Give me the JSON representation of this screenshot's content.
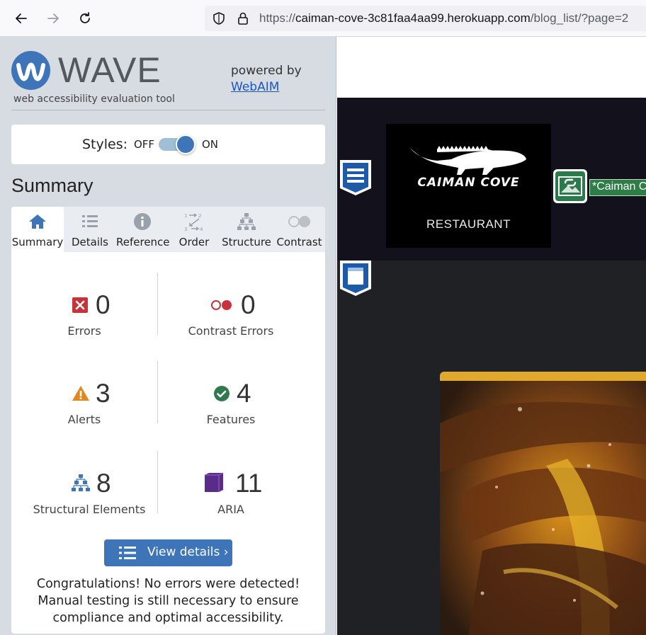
{
  "browser": {
    "url_prefix": "https://",
    "url_host": "caiman-cove-3c81faa4aa99.herokuapp.com",
    "url_path": "/blog_list/?page=2"
  },
  "wave": {
    "logo_word": "WAVE",
    "logo_sub": "web accessibility evaluation tool",
    "powered_by": "powered by",
    "webaim_link": "WebAIM",
    "styles_label": "Styles:",
    "styles_off": "OFF",
    "styles_on": "ON",
    "styles_state": "on",
    "summary_heading": "Summary",
    "tabs": [
      {
        "label": "Summary",
        "icon": "home-icon",
        "active": true
      },
      {
        "label": "Details",
        "icon": "list-icon",
        "active": false
      },
      {
        "label": "Reference",
        "icon": "info-icon",
        "active": false
      },
      {
        "label": "Order",
        "icon": "order-icon",
        "active": false
      },
      {
        "label": "Structure",
        "icon": "structure-icon",
        "active": false
      },
      {
        "label": "Contrast",
        "icon": "contrast-icon",
        "active": false
      }
    ],
    "stats": [
      {
        "label": "Errors",
        "value": "0",
        "icon": "error-icon",
        "color": "#c8323a"
      },
      {
        "label": "Contrast Errors",
        "value": "0",
        "icon": "contrast-error-icon",
        "color": "#c8323a"
      },
      {
        "label": "Alerts",
        "value": "3",
        "icon": "alert-icon",
        "color": "#e3861c"
      },
      {
        "label": "Features",
        "value": "4",
        "icon": "feature-icon",
        "color": "#2f7a4c"
      },
      {
        "label": "Structural Elements",
        "value": "8",
        "icon": "structure-icon",
        "color": "#3e75b8"
      },
      {
        "label": "ARIA",
        "value": "11",
        "icon": "aria-icon",
        "color": "#5b2b8a"
      }
    ],
    "view_details": "View details ›",
    "congrats": "Congratulations! No errors were detected! Manual testing is still necessary to ensure compliance and optimal accessibility."
  },
  "site": {
    "brand_name": "CAIMAN COVE",
    "brand_sub": "RESTAURANT",
    "alt_text_tag": "*Caiman C"
  }
}
